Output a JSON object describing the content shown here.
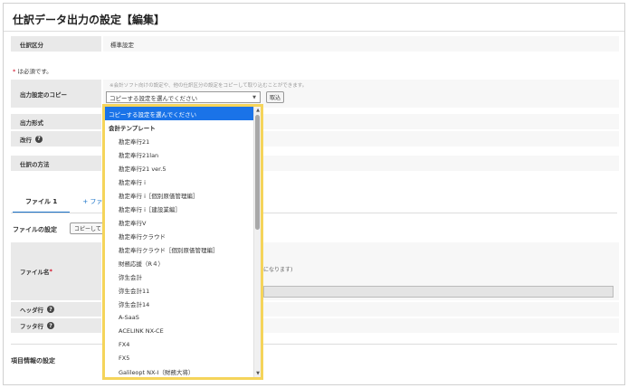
{
  "page": {
    "title": "仕訳データ出力の設定【編集】"
  },
  "journal_type": {
    "label": "仕訳区分",
    "value": "標準設定"
  },
  "required_note": {
    "star": "*",
    "text": "は必須です。"
  },
  "copy_setting": {
    "label": "出力設定のコピー",
    "hint": "※会計ソフト向けの設定や、他の仕訳区分の設定をコピーして取り込むことができます。",
    "selected": "コピーする設定を選んでください",
    "load_button": "取込"
  },
  "output_format": {
    "label": "出力形式"
  },
  "line_break": {
    "label": "改行"
  },
  "journal_method": {
    "label": "仕訳の方法"
  },
  "tabs": [
    {
      "label": "ファイル 1"
    },
    {
      "label": "+ ファ"
    }
  ],
  "file_settings": {
    "label": "ファイルの設定",
    "copy_button": "コピーして"
  },
  "file_name": {
    "label": "ファイル名",
    "star": "*",
    "note": "になります)"
  },
  "header_row": {
    "label": "ヘッダ行"
  },
  "footer_row": {
    "label": "フッタ行"
  },
  "item_settings": {
    "label": "項目情報の設定"
  },
  "dropdown": {
    "items": [
      {
        "label": "コピーする設定を選んでください",
        "kind": "selected"
      },
      {
        "label": "会計テンプレート",
        "kind": "group"
      },
      {
        "label": "勘定奉行21",
        "kind": "option"
      },
      {
        "label": "勘定奉行21lan",
        "kind": "option"
      },
      {
        "label": "勘定奉行21 ver.5",
        "kind": "option"
      },
      {
        "label": "勘定奉行 i",
        "kind": "option"
      },
      {
        "label": "勘定奉行 i［個別原価管理編］",
        "kind": "option"
      },
      {
        "label": "勘定奉行 i［建設業編］",
        "kind": "option"
      },
      {
        "label": "勘定奉行V",
        "kind": "option"
      },
      {
        "label": "勘定奉行クラウド",
        "kind": "option"
      },
      {
        "label": "勘定奉行クラウド［個別原価管理編］",
        "kind": "option"
      },
      {
        "label": "財務応援（R４）",
        "kind": "option"
      },
      {
        "label": "弥生会計",
        "kind": "option"
      },
      {
        "label": "弥生会計11",
        "kind": "option"
      },
      {
        "label": "弥生会計14",
        "kind": "option"
      },
      {
        "label": "A-SaaS",
        "kind": "option"
      },
      {
        "label": "ACELINK NX-CE",
        "kind": "option"
      },
      {
        "label": "FX4",
        "kind": "option"
      },
      {
        "label": "FX5",
        "kind": "option"
      },
      {
        "label": "Galileopt NX-I（財務大将）",
        "kind": "option"
      }
    ]
  },
  "icons": {
    "help": "question-circle-icon",
    "caret": "chevron-down-icon",
    "scroll_up": "scroll-up-arrow-icon",
    "scroll_down": "scroll-down-arrow-icon"
  },
  "colors": {
    "accent": "#1a73e8",
    "highlight_border": "#f5d45a",
    "required": "#d0021b",
    "label_bg": "#e9e9e9"
  }
}
